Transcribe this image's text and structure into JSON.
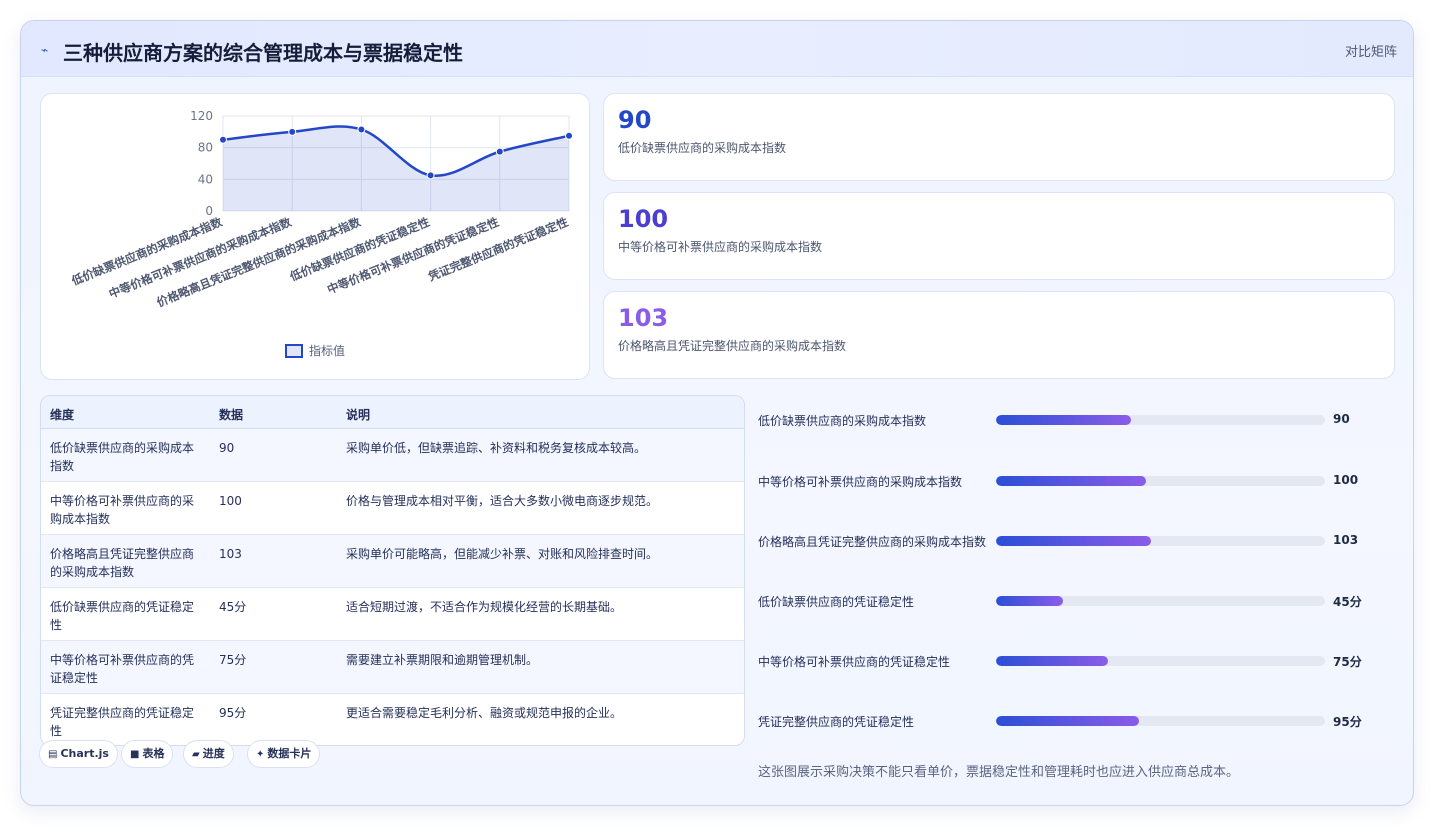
{
  "header": {
    "icon": "lightning-icon",
    "title": "三种供应商方案的综合管理成本与票据稳定性",
    "badge": "对比矩阵"
  },
  "chart_data": {
    "type": "line",
    "categories": [
      "低价缺票供应商的采购成本指数",
      "中等价格可补票供应商的采购成本指数",
      "价格略高且凭证完整供应商的采购成本指数",
      "低价缺票供应商的凭证稳定性",
      "中等价格可补票供应商的凭证稳定性",
      "凭证完整供应商的凭证稳定性"
    ],
    "series": [
      {
        "name": "指标值",
        "values": [
          90,
          100,
          103,
          45,
          75,
          95
        ]
      }
    ],
    "ylim": [
      0,
      120
    ],
    "yticks": [
      0,
      40,
      80,
      120
    ],
    "fill": true,
    "grid": true,
    "legend": "bottom",
    "color": "#2447c8"
  },
  "kpis": [
    {
      "value": "90",
      "label": "低价缺票供应商的采购成本指数",
      "color": "#2447c8"
    },
    {
      "value": "100",
      "label": "中等价格可补票供应商的采购成本指数",
      "color": "#4a3fd0"
    },
    {
      "value": "103",
      "label": "价格略高且凭证完整供应商的采购成本指数",
      "color": "#8b5ce8"
    }
  ],
  "table": {
    "headers": [
      "维度",
      "数据",
      "说明"
    ],
    "rows": [
      {
        "dim": "低价缺票供应商的采购成本指数",
        "value": "90",
        "desc": "采购单价低，但缺票追踪、补资料和税务复核成本较高。"
      },
      {
        "dim": "中等价格可补票供应商的采购成本指数",
        "value": "100",
        "desc": "价格与管理成本相对平衡，适合大多数小微电商逐步规范。"
      },
      {
        "dim": "价格略高且凭证完整供应商的采购成本指数",
        "value": "103",
        "desc": "采购单价可能略高，但能减少补票、对账和风险排查时间。"
      },
      {
        "dim": "低价缺票供应商的凭证稳定性",
        "value": "45分",
        "desc": "适合短期过渡，不适合作为规模化经营的长期基础。"
      },
      {
        "dim": "中等价格可补票供应商的凭证稳定性",
        "value": "75分",
        "desc": "需要建立补票期限和逾期管理机制。"
      },
      {
        "dim": "凭证完整供应商的凭证稳定性",
        "value": "95分",
        "desc": "更适合需要稳定毛利分析、融资或规范申报的企业。"
      }
    ]
  },
  "tags": [
    {
      "icon": "chart-icon",
      "label": "Chart.js"
    },
    {
      "icon": "table-icon",
      "label": "表格"
    },
    {
      "icon": "progress-icon",
      "label": "进度"
    },
    {
      "icon": "sparkle-icon",
      "label": "数据卡片"
    }
  ],
  "progress": [
    {
      "label": "低价缺票供应商的采购成本指数",
      "value": "90",
      "fraction": 0.41
    },
    {
      "label": "中等价格可补票供应商的采购成本指数",
      "value": "100",
      "fraction": 0.455
    },
    {
      "label": "价格略高且凭证完整供应商的采购成本指数",
      "value": "103",
      "fraction": 0.47
    },
    {
      "label": "低价缺票供应商的凭证稳定性",
      "value": "45分",
      "fraction": 0.205
    },
    {
      "label": "中等价格可补票供应商的凭证稳定性",
      "value": "75分",
      "fraction": 0.34
    },
    {
      "label": "凭证完整供应商的凭证稳定性",
      "value": "95分",
      "fraction": 0.435
    }
  ],
  "footnote": "这张图展示采购决策不能只看单价，票据稳定性和管理耗时也应进入供应商总成本。"
}
